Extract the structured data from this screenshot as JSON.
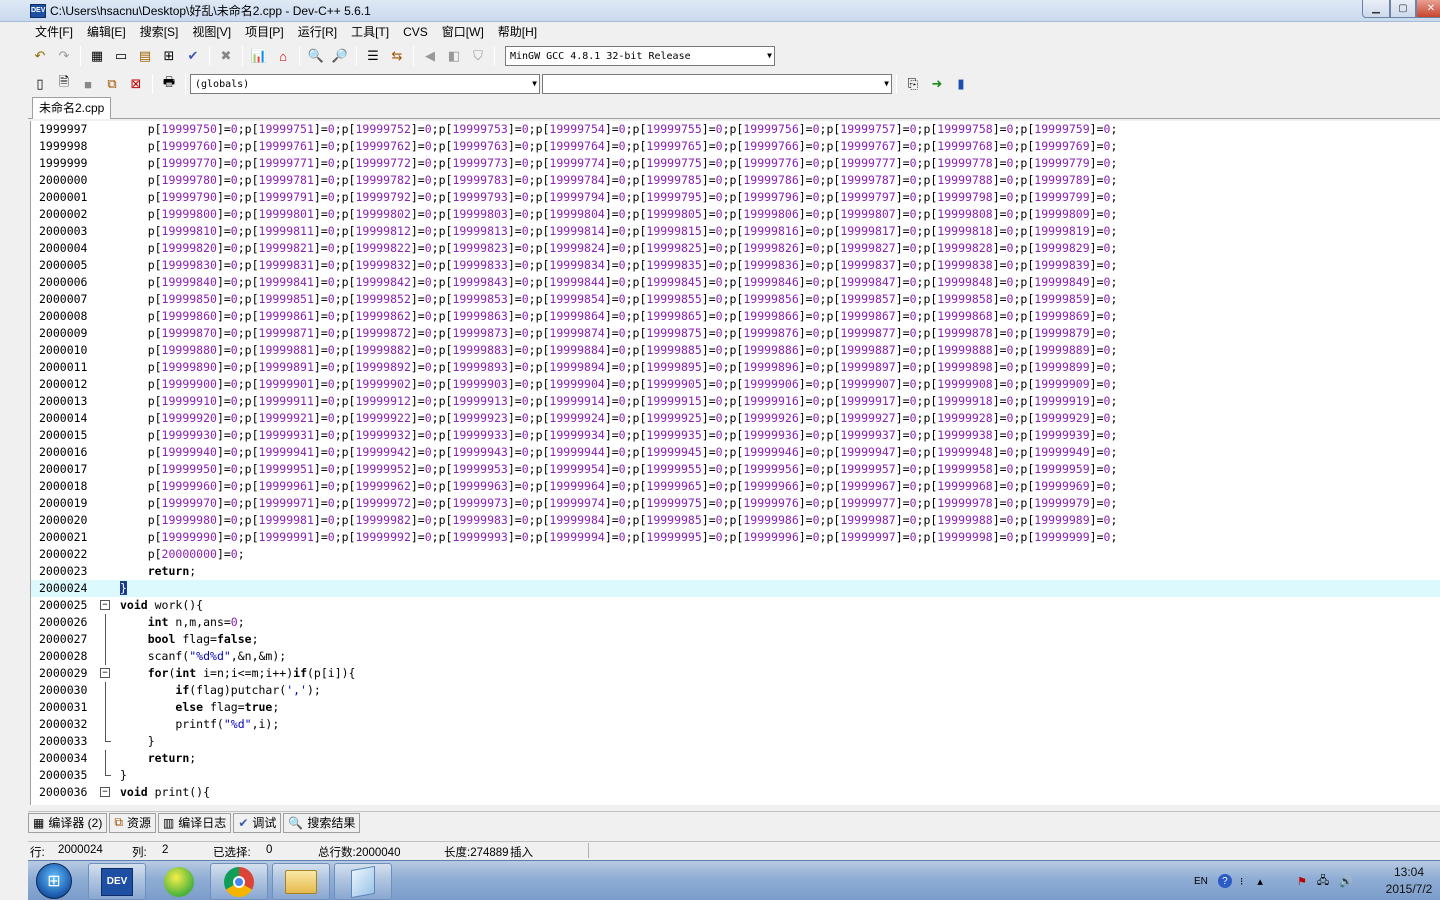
{
  "window": {
    "title": "C:\\Users\\hsacnu\\Desktop\\好乱\\未命名2.cpp - Dev-C++ 5.6.1",
    "icon": "dev-cpp-icon",
    "controls": [
      "minimize-icon",
      "maximize-icon",
      "close-icon"
    ]
  },
  "menu": [
    "文件[F]",
    "编辑[E]",
    "搜索[S]",
    "视图[V]",
    "项目[P]",
    "运行[R]",
    "工具[T]",
    "CVS",
    "窗口[W]",
    "帮助[H]"
  ],
  "toolbar": {
    "compiler": "MinGW GCC 4.8.1 32-bit Release",
    "scope": "(globals)",
    "function": ""
  },
  "file_tab": "未命名2.cpp",
  "editor": {
    "current_line": "2000024",
    "lines": [
      {
        "n": "1999997",
        "start": 19999750
      },
      {
        "n": "1999998",
        "start": 19999760
      },
      {
        "n": "1999999",
        "start": 19999770
      },
      {
        "n": "2000000",
        "start": 19999780
      },
      {
        "n": "2000001",
        "start": 19999790
      },
      {
        "n": "2000002",
        "start": 19999800
      },
      {
        "n": "2000003",
        "start": 19999810
      },
      {
        "n": "2000004",
        "start": 19999820
      },
      {
        "n": "2000005",
        "start": 19999830
      },
      {
        "n": "2000006",
        "start": 19999840
      },
      {
        "n": "2000007",
        "start": 19999850
      },
      {
        "n": "2000008",
        "start": 19999860
      },
      {
        "n": "2000009",
        "start": 19999870
      },
      {
        "n": "2000010",
        "start": 19999880
      },
      {
        "n": "2000011",
        "start": 19999890
      },
      {
        "n": "2000012",
        "start": 19999900
      },
      {
        "n": "2000013",
        "start": 19999910
      },
      {
        "n": "2000014",
        "start": 19999920
      },
      {
        "n": "2000015",
        "start": 19999930
      },
      {
        "n": "2000016",
        "start": 19999940
      },
      {
        "n": "2000017",
        "start": 19999950
      },
      {
        "n": "2000018",
        "start": 19999960
      },
      {
        "n": "2000019",
        "start": 19999970
      },
      {
        "n": "2000020",
        "start": 19999980
      },
      {
        "n": "2000021",
        "start": 19999990
      },
      {
        "n": "2000022",
        "text": "    p[20000000]=0;"
      },
      {
        "n": "2000023",
        "text": "    return;"
      },
      {
        "n": "2000024",
        "text": "}",
        "current": true
      },
      {
        "n": "2000025",
        "text": "void work(){",
        "fold": "open"
      },
      {
        "n": "2000026",
        "text": "    int n,m,ans=0;",
        "fold": "line"
      },
      {
        "n": "2000027",
        "text": "    bool flag=false;",
        "fold": "line"
      },
      {
        "n": "2000028",
        "text": "    scanf(\"%d%d\",&n,&m);",
        "fold": "line"
      },
      {
        "n": "2000029",
        "text": "    for(int i=n;i<=m;i++)if(p[i]){",
        "fold": "open"
      },
      {
        "n": "2000030",
        "text": "        if(flag)putchar(',');",
        "fold": "line"
      },
      {
        "n": "2000031",
        "text": "        else flag=true;",
        "fold": "line"
      },
      {
        "n": "2000032",
        "text": "        printf(\"%d\",i);",
        "fold": "line"
      },
      {
        "n": "2000033",
        "text": "    }",
        "fold": "end"
      },
      {
        "n": "2000034",
        "text": "    return;",
        "fold": "line"
      },
      {
        "n": "2000035",
        "text": "}",
        "fold": "end"
      },
      {
        "n": "2000036",
        "text": "void print(){",
        "fold": "open"
      }
    ]
  },
  "bottom_tabs": [
    {
      "label": "编译器 (2)",
      "icon": "compiler-grid-icon"
    },
    {
      "label": "资源",
      "icon": "resources-icon"
    },
    {
      "label": "编译日志",
      "icon": "compile-log-chart-icon"
    },
    {
      "label": "调试",
      "icon": "debug-check-icon"
    },
    {
      "label": "搜索结果",
      "icon": "search-results-icon"
    }
  ],
  "status": {
    "row_label": "行:",
    "row": "2000024",
    "col_label": "列:",
    "col": "2",
    "selected_label": "已选择:",
    "selected": "0",
    "total_lines": "总行数:2000040",
    "length": "长度:274889",
    "mode": "插入"
  },
  "taskbar": {
    "apps": [
      "start-orb-icon",
      "dev-cpp-taskbar-icon",
      "sogou-input-icon",
      "chrome-icon",
      "file-explorer-icon",
      "notepad-icon"
    ],
    "tray": {
      "lang": "EN",
      "time": "13:04",
      "date": "2015/7/2"
    }
  }
}
